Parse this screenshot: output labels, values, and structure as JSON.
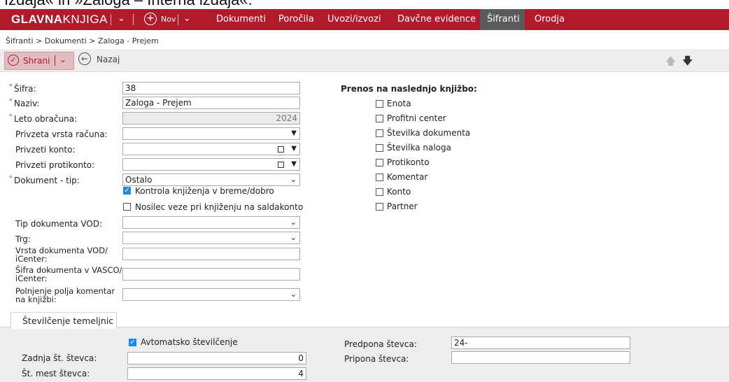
{
  "caption": "Izdaja« in »Zaloga – Interna izdaja«.",
  "nav": {
    "brand_bold": "GLAVNA",
    "brand_light": "KNJIGA",
    "new_label": "Nov",
    "items": [
      "Dokumenti",
      "Poročila",
      "Uvozi/izvozi",
      "Davčne evidence",
      "Šifranti",
      "Orodja"
    ],
    "active_index": 4
  },
  "breadcrumb": "Šifranti > Dokumenti > Zaloga - Prejem",
  "toolbar": {
    "save_label": "Shrani",
    "back_label": "Nazaj"
  },
  "form": {
    "sifra": {
      "label": "Šifra:",
      "value": "38"
    },
    "naziv": {
      "label": "Naziv:",
      "value": "Zaloga - Prejem"
    },
    "leto": {
      "label": "Leto obračuna:",
      "value": "2024"
    },
    "privzeta_vrsta": {
      "label": "Privzeta vrsta računa:",
      "value": ""
    },
    "privzeti_konto": {
      "label": "Privzeti konto:",
      "value": ""
    },
    "privzeti_protikonto": {
      "label": "Privzeti protikonto:",
      "value": ""
    },
    "dokument_tip": {
      "label": "Dokument - tip:",
      "value": "Ostalo"
    },
    "kontrola": {
      "label": "Kontrola knjiženja v breme/dobro",
      "checked": true
    },
    "nosilec": {
      "label": "Nosilec veze pri knjiženju na saldakonto",
      "checked": false
    },
    "tip_vod": {
      "label": "Tip dokumenta VOD:",
      "value": ""
    },
    "trg": {
      "label": "Trg:",
      "value": ""
    },
    "vrsta_vod_1": "Vrsta dokumenta VOD/",
    "vrsta_vod_2": "iCenter:",
    "sifra_vasco_1": "Šifra dokumenta v VASCO/",
    "sifra_vasco_2": "iCenter:",
    "polnjenje_1": "Polnjenje polja komentar",
    "polnjenje_2": "na knjižbi:"
  },
  "prenos": {
    "title": "Prenos na naslednjo knjižbo:",
    "items": [
      "Enota",
      "Profitni center",
      "Številka dokumenta",
      "Številka naloga",
      "Protikonto",
      "Komentar",
      "Konto",
      "Partner"
    ]
  },
  "tab": {
    "label": "Številčenje temeljnic",
    "avtomatsko": {
      "label": "Avtomatsko številčenje",
      "checked": true
    },
    "zadnja": {
      "label": "Zadnja št. števca:",
      "value": "0"
    },
    "mest": {
      "label": "Št. mest števca:",
      "value": "4"
    },
    "predpona": {
      "label": "Predpona števca:",
      "value": "24-"
    },
    "pripona": {
      "label": "Pripona števca:",
      "value": ""
    }
  },
  "colors": {
    "brand_red": "#b01a2a",
    "active_tab": "#5a5a5a",
    "check_blue": "#1e88e5"
  },
  "icons": [
    "chevron-down-icon",
    "plus-circle-icon",
    "check-circle-icon",
    "arrow-left-circle-icon",
    "arrow-up-icon",
    "arrow-down-icon"
  ]
}
